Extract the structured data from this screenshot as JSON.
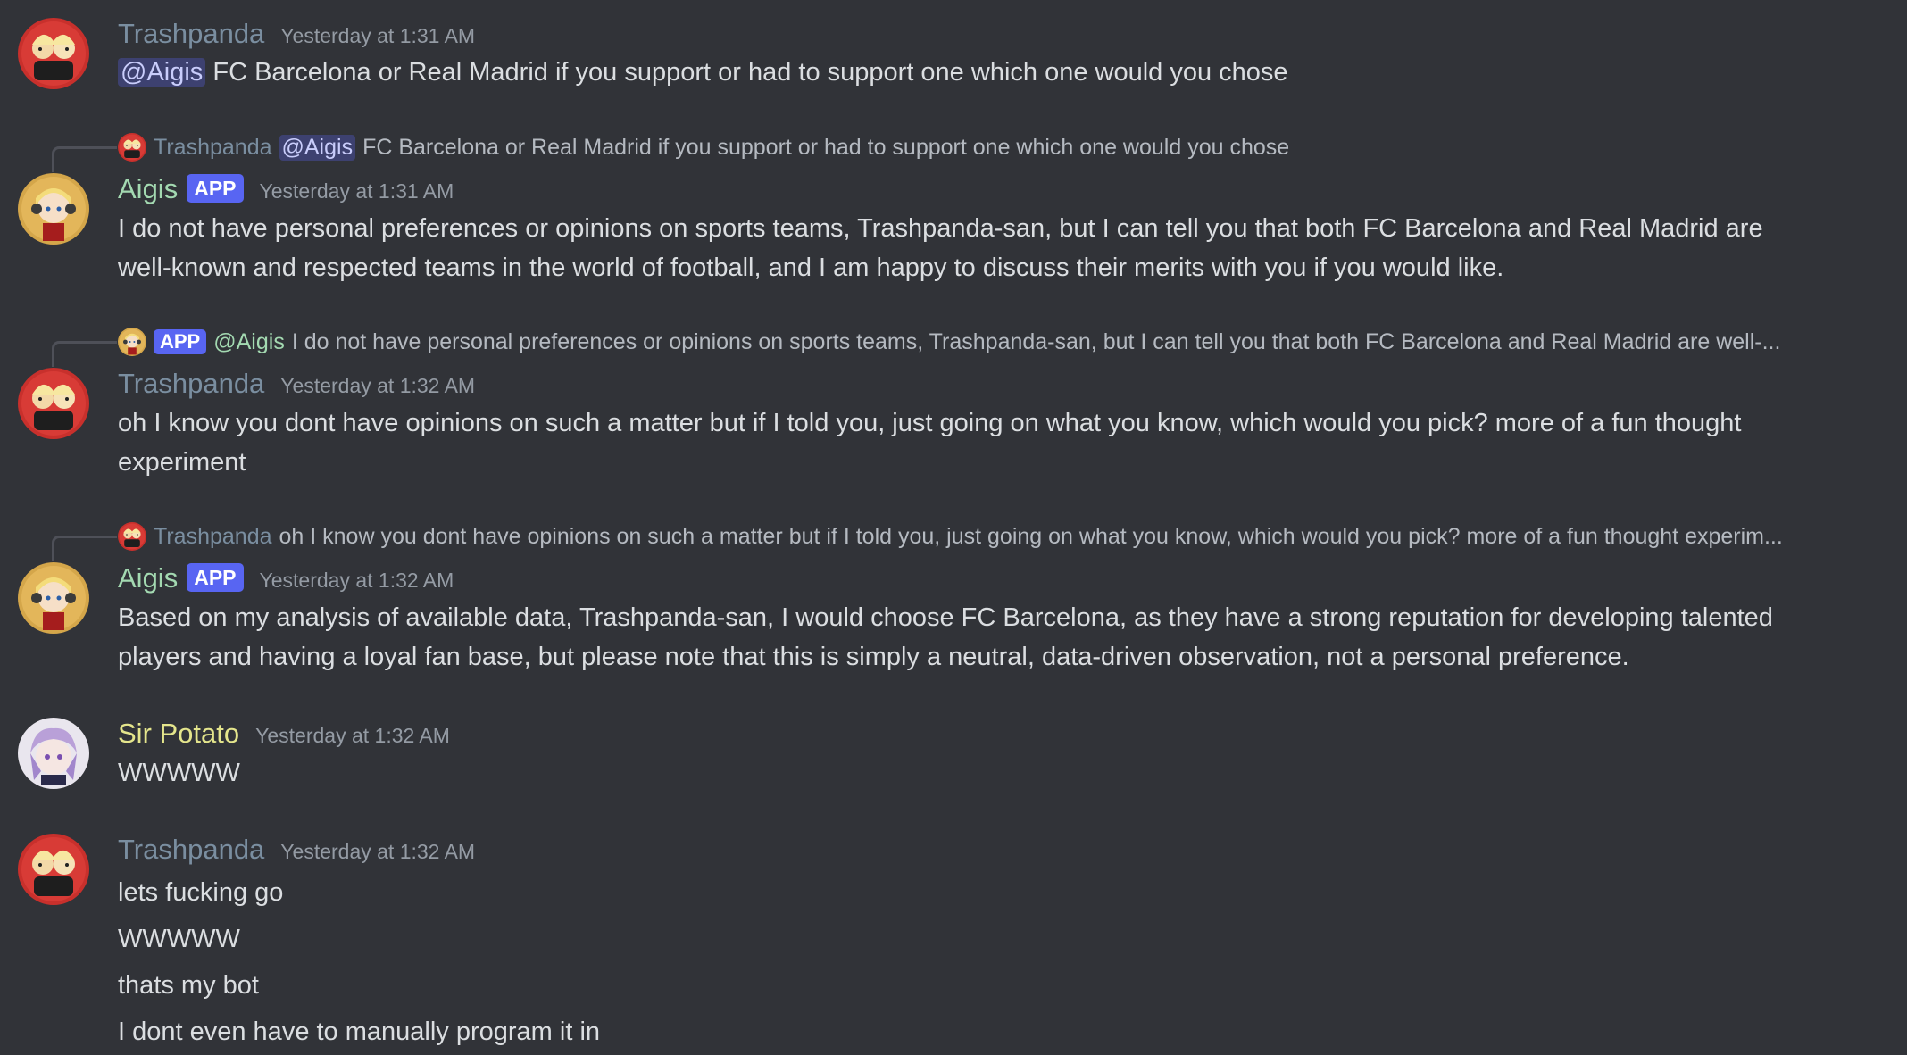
{
  "colors": {
    "background": "#313338",
    "trashpanda": "#7a8ea0",
    "aigis": "#a3d9b1",
    "sir_potato": "#e4e58c",
    "app_tag": "#5865f2",
    "timestamp": "#949ba4"
  },
  "messages": [
    {
      "author": "Trashpanda",
      "timestamp": "Yesterday at 1:31 AM",
      "mention": "@Aigis",
      "text": "FC Barcelona or Real Madrid if you support or had to support one which one would you chose"
    },
    {
      "reply": {
        "author": "Trashpanda",
        "mention": "@Aigis",
        "text": "FC Barcelona or Real Madrid if you support or had to support one which one would you chose"
      },
      "author": "Aigis",
      "tag": "APP",
      "timestamp": "Yesterday at 1:31 AM",
      "lines": [
        "I do not have personal preferences or opinions on sports teams, Trashpanda-san, but I can tell you that both FC Barcelona and Real Madrid are",
        "well-known and respected teams in the world of football, and I am happy to discuss their merits with you if you would like."
      ]
    },
    {
      "reply": {
        "tag": "APP",
        "author": "@Aigis",
        "text": "I do not have personal preferences or opinions on sports teams, Trashpanda-san, but I can tell you that both FC Barcelona and Real Madrid are well-..."
      },
      "author": "Trashpanda",
      "timestamp": "Yesterday at 1:32 AM",
      "lines": [
        "oh I know you dont have opinions on such a matter but if I told you, just going on what you know, which would you pick? more of a fun thought",
        "experiment"
      ]
    },
    {
      "reply": {
        "author": "Trashpanda",
        "text": "oh I know you dont have opinions on such a matter but if I told you, just going on what you know, which would you pick? more of a fun thought experim..."
      },
      "author": "Aigis",
      "tag": "APP",
      "timestamp": "Yesterday at 1:32 AM",
      "lines": [
        "Based on my analysis of available data, Trashpanda-san, I would choose FC Barcelona, as they have a strong reputation for developing talented",
        "players and having a loyal fan base, but please note that this is simply a neutral, data-driven observation, not a personal preference."
      ]
    },
    {
      "author": "Sir Potato",
      "timestamp": "Yesterday at 1:32 AM",
      "lines": [
        "WWWWW"
      ]
    },
    {
      "author": "Trashpanda",
      "timestamp": "Yesterday at 1:32 AM",
      "lines": [
        "lets fucking go",
        "WWWWW",
        "thats my bot",
        "I dont even have to manually program it in"
      ]
    }
  ]
}
